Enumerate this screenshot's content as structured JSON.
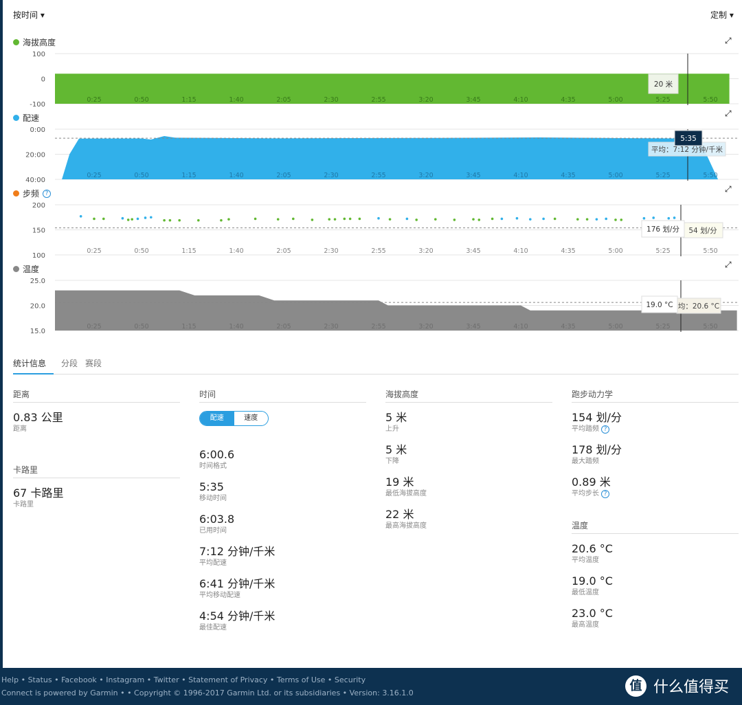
{
  "header": {
    "group_by": "按时间",
    "customize": "定制"
  },
  "charts": [
    {
      "title": "海拔高度",
      "color": "#62b832",
      "icon": "expand-icon",
      "yticks": [
        "100",
        "0",
        "-100"
      ],
      "tooltip": "20 米"
    },
    {
      "title": "配速",
      "color": "#31b0ea",
      "yticks": [
        "0:00",
        "20:00",
        "40:00"
      ],
      "tooltip": "5:35",
      "avg_label": "平均：7:12 分钟/千米"
    },
    {
      "title": "步频",
      "color": "#f07d1a",
      "yticks": [
        "200",
        "150",
        "100"
      ],
      "tooltip": "176 划/分",
      "avg_label": "54 划/分"
    },
    {
      "title": "温度",
      "color": "#888888",
      "yticks": [
        "25.0",
        "20.0",
        "15.0"
      ],
      "tooltip": "19.0 °C",
      "avg_label": "均：20.6 °C"
    }
  ],
  "xticks": [
    "0:25",
    "0:50",
    "1:15",
    "1:40",
    "2:05",
    "2:30",
    "2:55",
    "3:20",
    "3:45",
    "4:10",
    "4:35",
    "5:00",
    "5:25",
    "5:50"
  ],
  "chart_data": [
    {
      "type": "area",
      "title": "海拔高度",
      "ylim": [
        -100,
        100
      ],
      "x_seconds_cursor": 335,
      "values": [
        [
          0,
          20
        ],
        [
          360,
          20
        ]
      ]
    },
    {
      "type": "area",
      "title": "配速",
      "ylim": [
        0,
        40
      ],
      "y_unit": "min/km inverted",
      "average": 7.2,
      "values": [
        [
          8,
          40
        ],
        [
          12,
          20
        ],
        [
          17,
          7.5
        ],
        [
          50,
          7.4
        ],
        [
          55,
          8.2
        ],
        [
          62,
          5.5
        ],
        [
          68,
          6.8
        ],
        [
          120,
          7.3
        ],
        [
          200,
          7.0
        ],
        [
          260,
          6.6
        ],
        [
          300,
          7.1
        ],
        [
          335,
          7.4
        ],
        [
          344,
          7.4
        ],
        [
          354,
          40
        ]
      ]
    },
    {
      "type": "scatter",
      "title": "步频",
      "ylim": [
        100,
        200
      ],
      "average": 154,
      "points": [
        [
          18,
          177,
          "b"
        ],
        [
          25,
          172,
          "g"
        ],
        [
          30,
          172,
          "g"
        ],
        [
          40,
          173,
          "b"
        ],
        [
          43,
          170,
          "g"
        ],
        [
          45,
          171,
          "g"
        ],
        [
          48,
          172,
          "b"
        ],
        [
          52,
          174,
          "b"
        ],
        [
          55,
          175,
          "b"
        ],
        [
          62,
          169,
          "g"
        ],
        [
          65,
          169,
          "g"
        ],
        [
          70,
          169,
          "g"
        ],
        [
          80,
          169,
          "g"
        ],
        [
          92,
          169,
          "g"
        ],
        [
          96,
          171,
          "g"
        ],
        [
          110,
          172,
          "g"
        ],
        [
          122,
          171,
          "g"
        ],
        [
          130,
          172,
          "g"
        ],
        [
          140,
          170,
          "g"
        ],
        [
          149,
          171,
          "g"
        ],
        [
          152,
          171,
          "g"
        ],
        [
          157,
          172,
          "g"
        ],
        [
          160,
          172,
          "g"
        ],
        [
          165,
          172,
          "g"
        ],
        [
          175,
          173,
          "b"
        ],
        [
          181,
          171,
          "g"
        ],
        [
          190,
          172,
          "b"
        ],
        [
          195,
          170,
          "g"
        ],
        [
          205,
          171,
          "g"
        ],
        [
          215,
          170,
          "g"
        ],
        [
          225,
          171,
          "g"
        ],
        [
          228,
          170,
          "g"
        ],
        [
          235,
          172,
          "g"
        ],
        [
          240,
          172,
          "b"
        ],
        [
          248,
          173,
          "b"
        ],
        [
          255,
          171,
          "b"
        ],
        [
          262,
          172,
          "b"
        ],
        [
          268,
          172,
          "g"
        ],
        [
          280,
          171,
          "g"
        ],
        [
          285,
          171,
          "g"
        ],
        [
          290,
          171,
          "b"
        ],
        [
          295,
          172,
          "b"
        ],
        [
          300,
          170,
          "g"
        ],
        [
          303,
          170,
          "g"
        ],
        [
          315,
          173,
          "b"
        ],
        [
          320,
          174,
          "b"
        ],
        [
          328,
          173,
          "b"
        ],
        [
          331,
          174,
          "b"
        ]
      ]
    },
    {
      "type": "area",
      "title": "温度",
      "ylim": [
        15,
        25
      ],
      "average": 20.6,
      "values": [
        [
          0,
          23
        ],
        [
          70,
          23
        ],
        [
          78,
          22
        ],
        [
          112,
          22
        ],
        [
          120,
          21
        ],
        [
          175,
          21
        ],
        [
          180,
          20
        ],
        [
          250,
          20
        ],
        [
          255,
          19
        ],
        [
          364,
          19
        ]
      ]
    }
  ],
  "tabs": [
    "统计信息",
    "分段",
    "赛段"
  ],
  "stats": {
    "distance": {
      "title": "距离",
      "items": [
        {
          "value": "0.83 公里",
          "label": "距离"
        }
      ]
    },
    "calories": {
      "title": "卡路里",
      "items": [
        {
          "value": "67 卡路里",
          "label": "卡路里"
        }
      ]
    },
    "time": {
      "title": "时间",
      "toggle": [
        "配速",
        "速度"
      ],
      "items": [
        {
          "value": "6:00.6",
          "label": "时间格式"
        },
        {
          "value": "5:35",
          "label": "移动时间"
        },
        {
          "value": "6:03.8",
          "label": "已用时间"
        },
        {
          "value": "7:12 分钟/千米",
          "label": "平均配速"
        },
        {
          "value": "6:41 分钟/千米",
          "label": "平均移动配速"
        },
        {
          "value": "4:54 分钟/千米",
          "label": "最佳配速"
        }
      ]
    },
    "elevation": {
      "title": "海拔高度",
      "items": [
        {
          "value": "5 米",
          "label": "上升"
        },
        {
          "value": "5 米",
          "label": "下降"
        },
        {
          "value": "19 米",
          "label": "最低海拔高度"
        },
        {
          "value": "22 米",
          "label": "最高海拔高度"
        }
      ]
    },
    "dynamics": {
      "title": "跑步动力学",
      "items": [
        {
          "value": "154 划/分",
          "label": "平均踏频",
          "help": true
        },
        {
          "value": "178 划/分",
          "label": "最大踏频"
        },
        {
          "value": "0.89 米",
          "label": "平均步长",
          "help": true
        }
      ]
    },
    "temperature": {
      "title": "温度",
      "items": [
        {
          "value": "20.6 °C",
          "label": "平均温度"
        },
        {
          "value": "19.0 °C",
          "label": "最低温度"
        },
        {
          "value": "23.0 °C",
          "label": "最高温度"
        }
      ]
    }
  },
  "footer": {
    "links": [
      "Help",
      "Status",
      "Facebook",
      "Instagram",
      "Twitter",
      "Statement of Privacy",
      "Terms of Use",
      "Security"
    ],
    "line2": "Connect is powered by Garmin • • Copyright © 1996-2017 Garmin Ltd. or its subsidiaries • Version: 3.16.1.0",
    "logo_text": "什么值得买",
    "logo_char": "值"
  }
}
